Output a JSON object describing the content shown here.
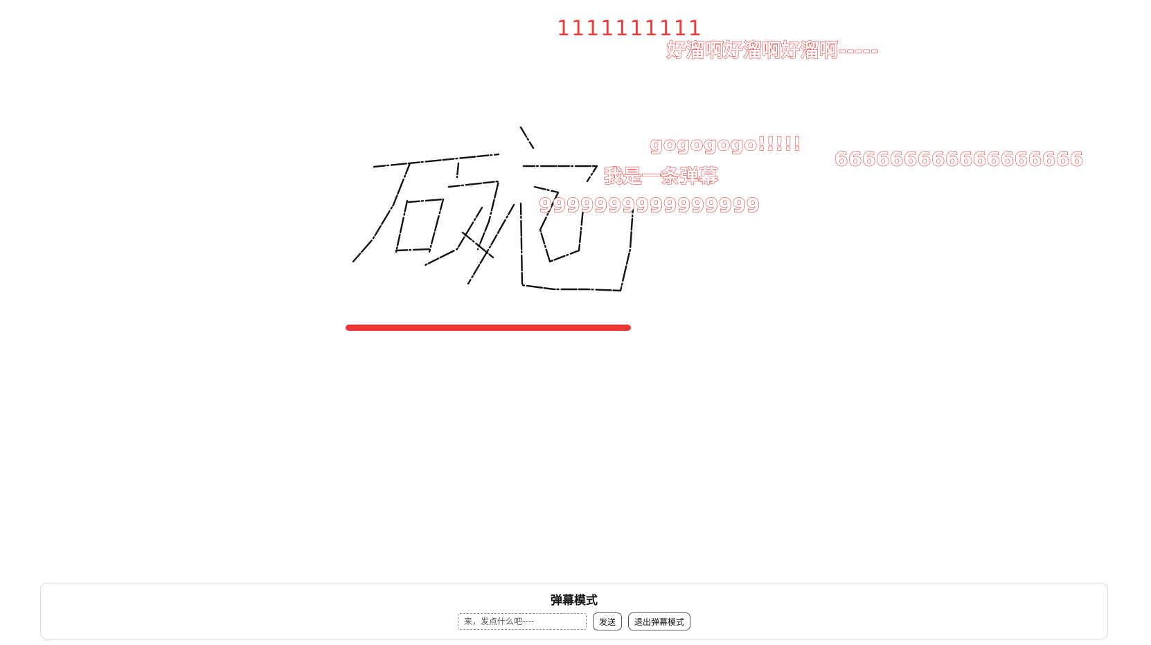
{
  "danmaku": [
    "1111111111",
    "好溜啊好溜啊好溜啊-----",
    "gogogogo!!!!!",
    "666666666666666666",
    "我是一条弹幕",
    "9999999999999999"
  ],
  "panel": {
    "title": "弹幕模式",
    "input_placeholder": "来，发点什么吧----",
    "input_value": "",
    "send_label": "发送",
    "exit_label": "退出弹幕模式"
  },
  "colors": {
    "danmaku_stroke": "#ef3b3b",
    "underline": "#f03535",
    "ink": "#111111"
  }
}
